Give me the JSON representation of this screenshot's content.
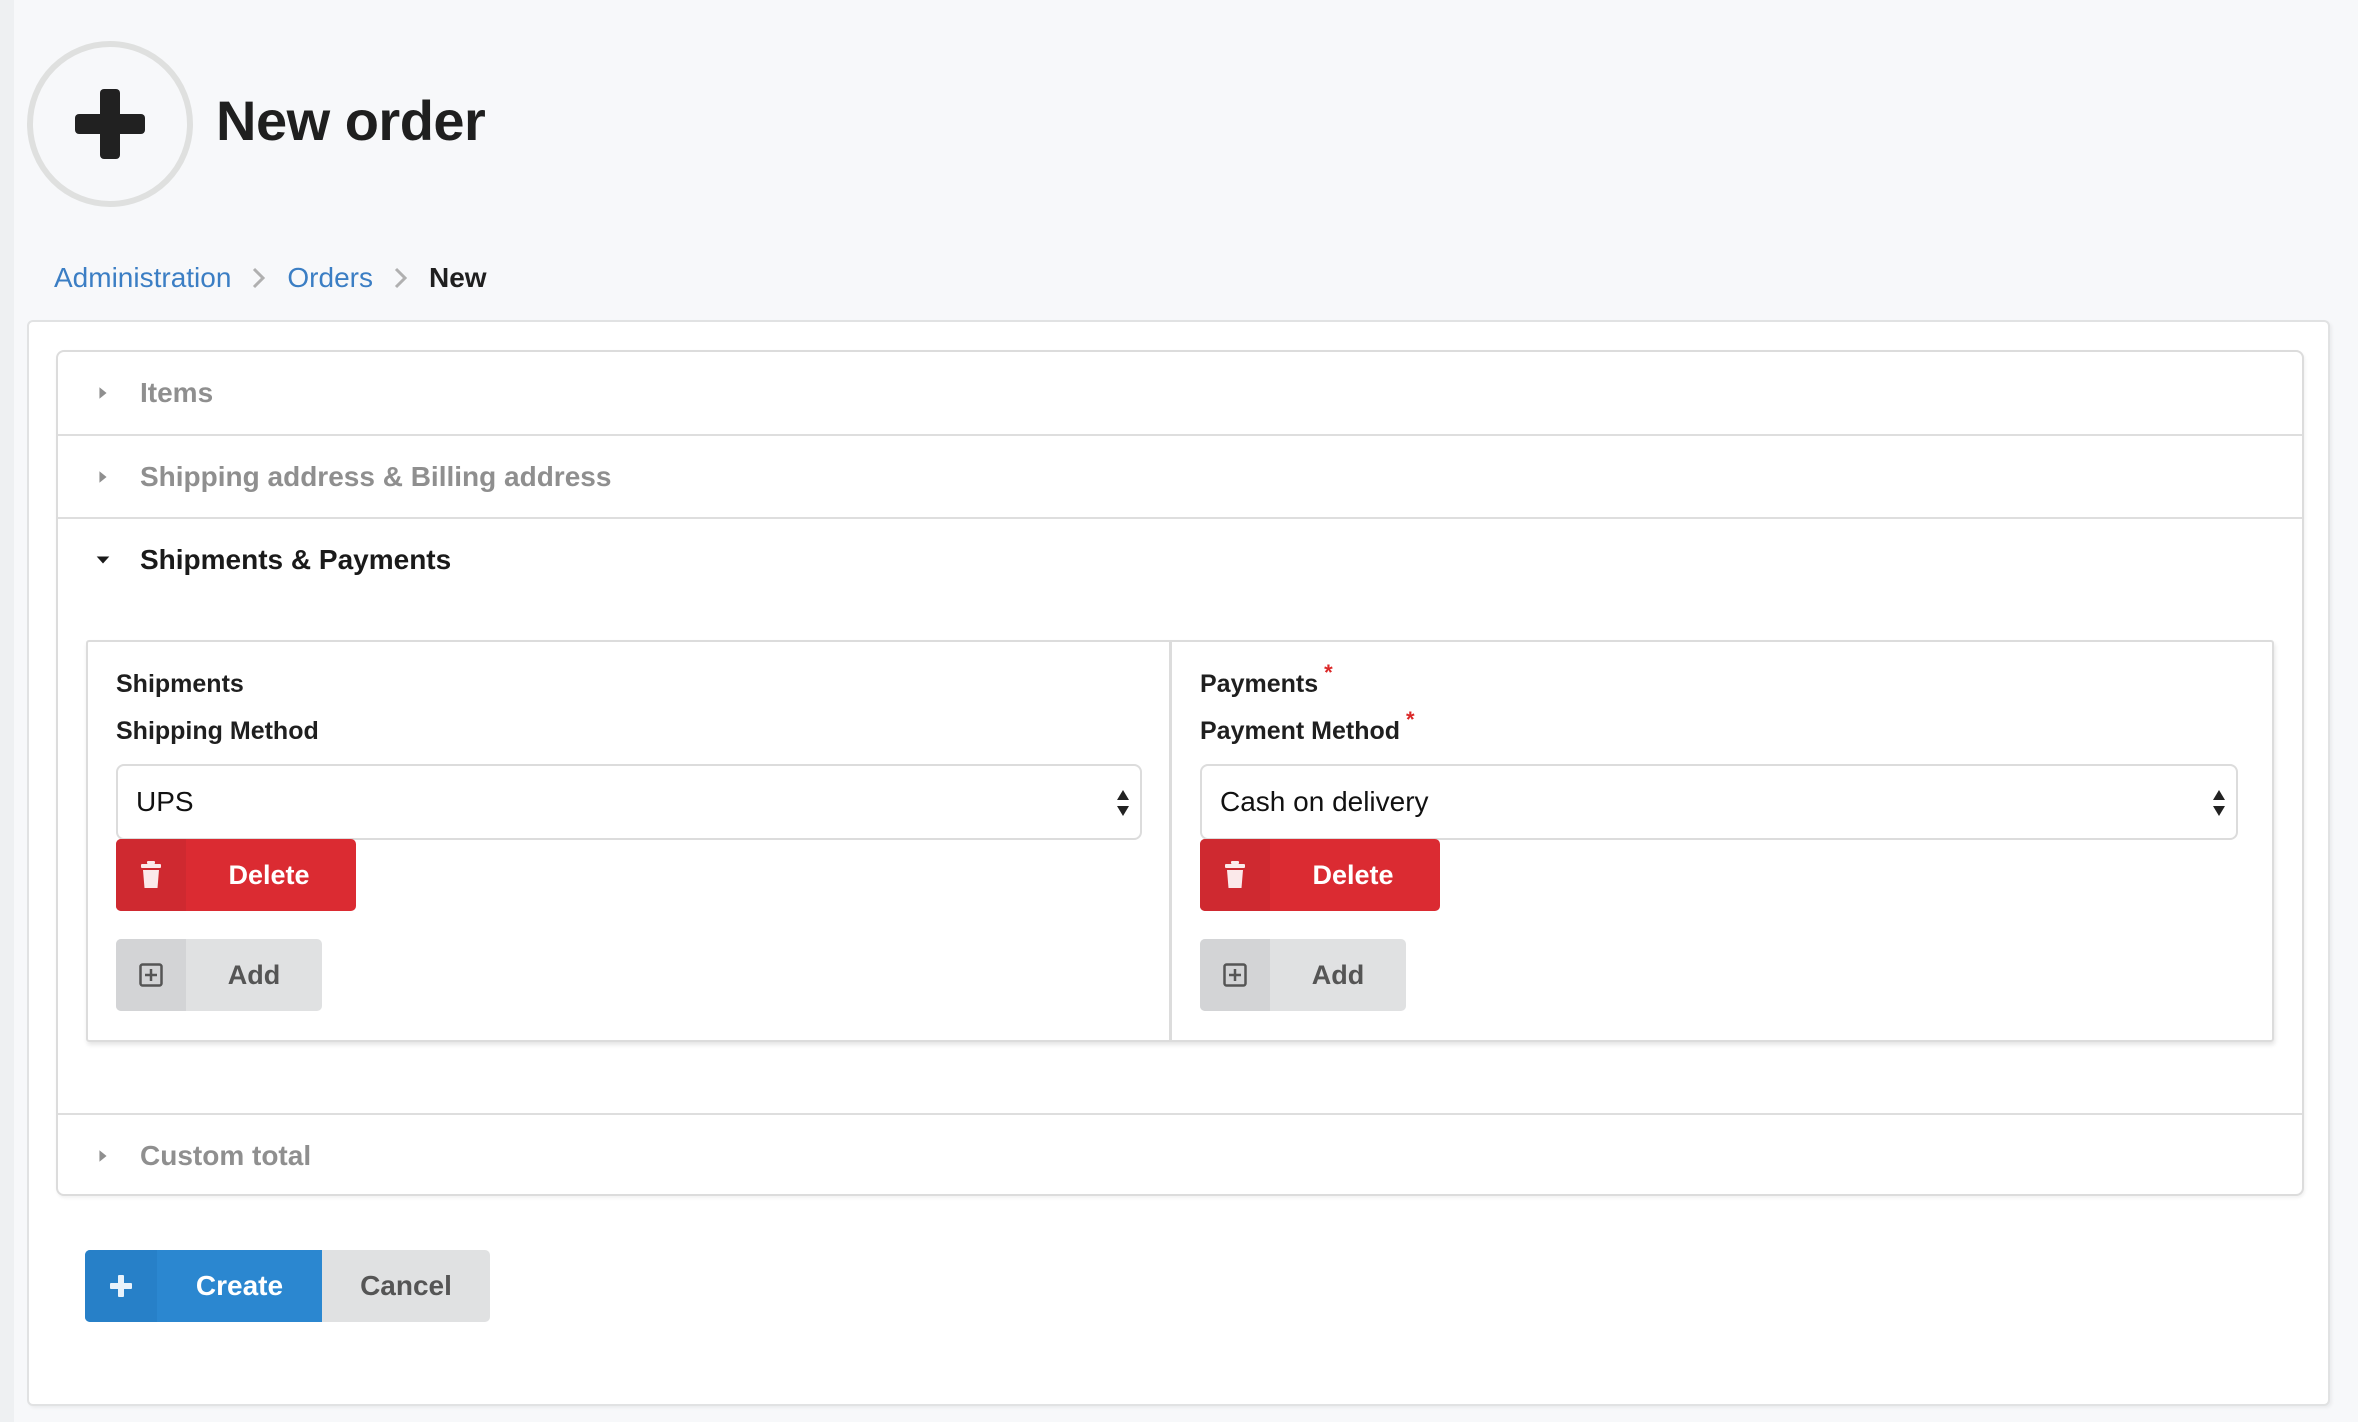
{
  "header": {
    "icon": "plus-icon",
    "title": "New order"
  },
  "breadcrumb": {
    "items": [
      {
        "label": "Administration",
        "link": true
      },
      {
        "label": "Orders",
        "link": true
      },
      {
        "label": "New",
        "link": false
      }
    ],
    "separator_icon": "chevron-right-icon"
  },
  "accordion": {
    "sections": [
      {
        "title": "Items",
        "expanded": false
      },
      {
        "title": "Shipping address & Billing address",
        "expanded": false
      },
      {
        "title": "Shipments & Payments",
        "expanded": true
      },
      {
        "title": "Custom total",
        "expanded": false
      }
    ]
  },
  "shipments": {
    "title": "Shipments",
    "required": false,
    "method_label": "Shipping Method",
    "method_required": false,
    "method_value": "UPS",
    "delete_label": "Delete",
    "delete_icon": "trash-icon",
    "add_label": "Add",
    "add_icon": "plus-square-icon"
  },
  "payments": {
    "title": "Payments",
    "required": true,
    "method_label": "Payment Method",
    "method_required": true,
    "method_value": "Cash on delivery",
    "delete_label": "Delete",
    "delete_icon": "trash-icon",
    "add_label": "Add",
    "add_icon": "plus-square-icon"
  },
  "required_marker": "*",
  "actions": {
    "create_label": "Create",
    "create_icon": "plus-icon",
    "cancel_label": "Cancel"
  },
  "colors": {
    "primary": "#2b87d0",
    "danger": "#db2b32",
    "link": "#3b7ec4",
    "secondary": "#e0e1e2"
  }
}
